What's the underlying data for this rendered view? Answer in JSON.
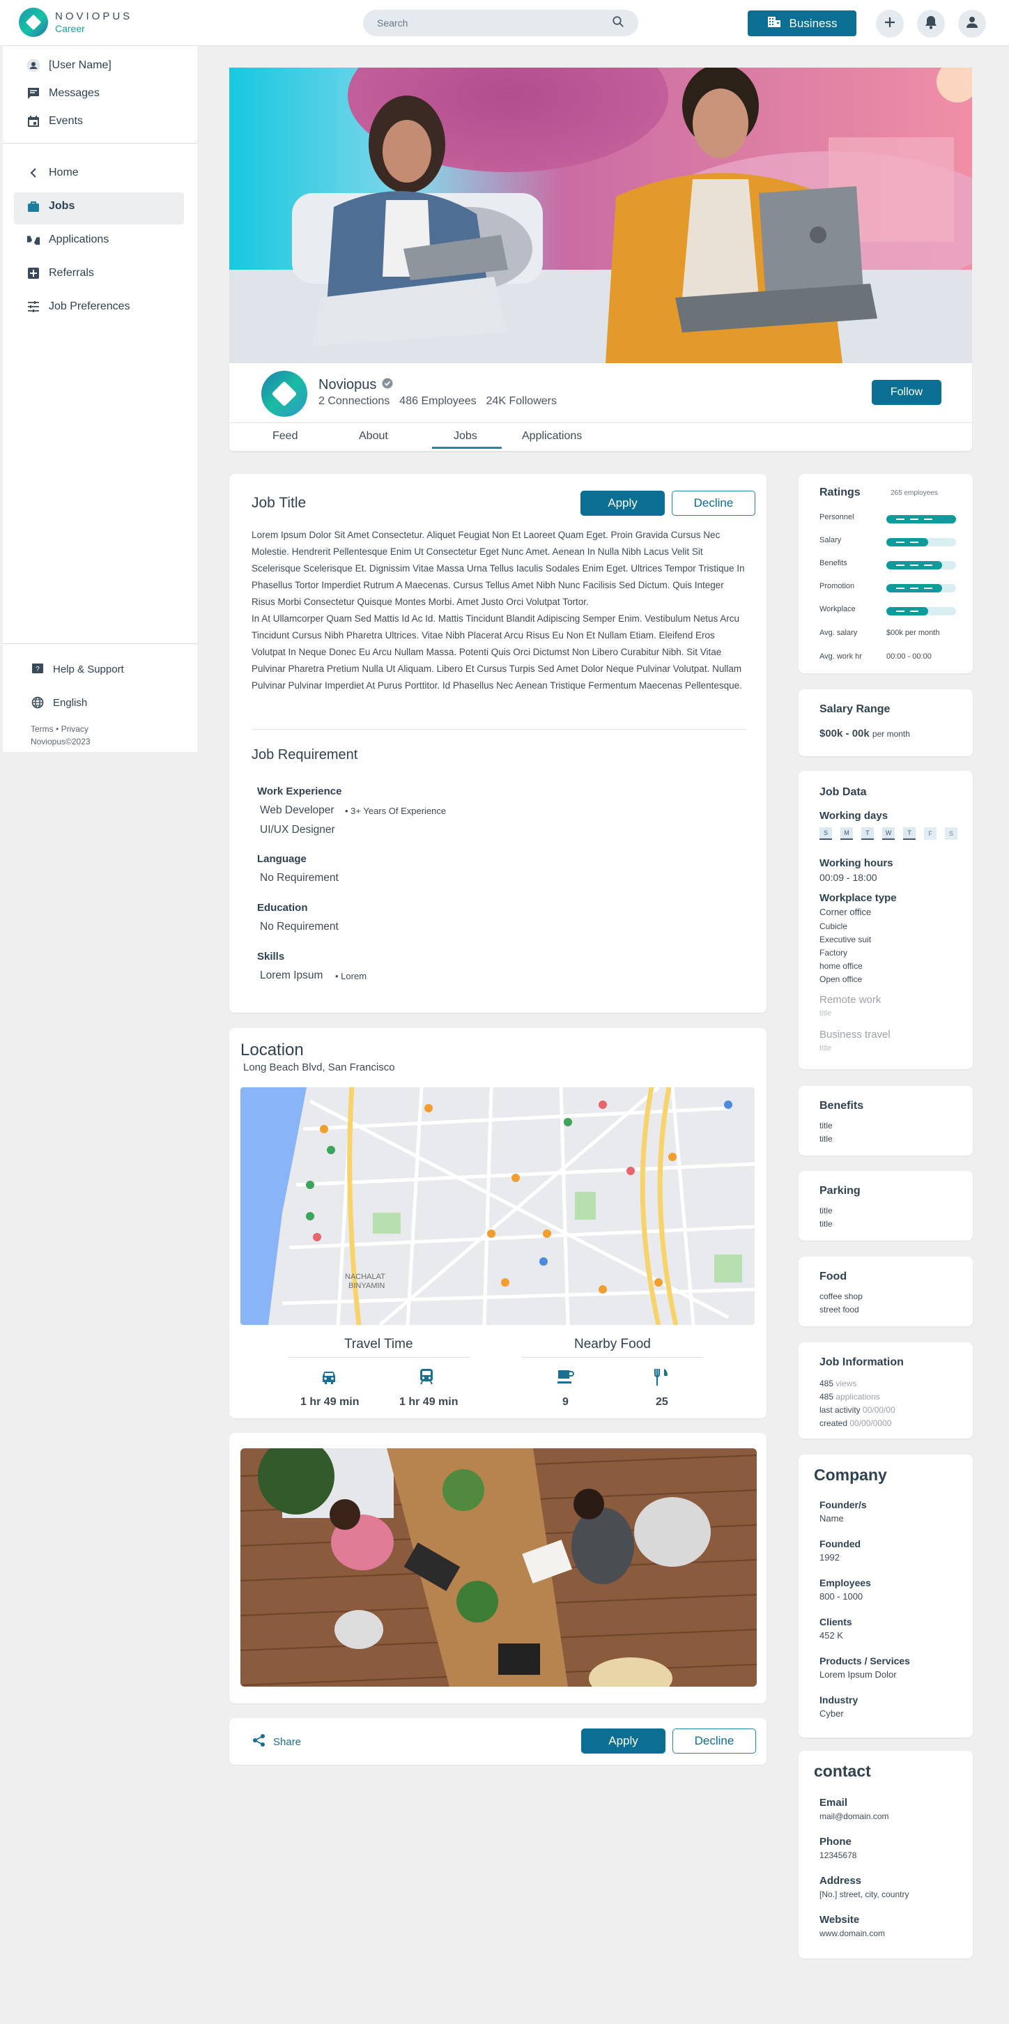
{
  "header": {
    "brand": "NOVIOPUS",
    "brand_sub": "Career",
    "search_placeholder": "Search",
    "business_label": "Business"
  },
  "sidebar": {
    "user_name": "[User Name]",
    "messages": "Messages",
    "events": "Events",
    "home": "Home",
    "jobs": "Jobs",
    "applications": "Applications",
    "referrals": "Referrals",
    "job_preferences": "Job Preferences",
    "help": "Help & Support",
    "language": "English",
    "terms": "Terms",
    "privacy": "Privacy",
    "copyright": "Noviopus©2023"
  },
  "company_profile": {
    "name": "Noviopus",
    "connections": "2 Connections",
    "employees": "486 Employees",
    "followers": "24K Followers",
    "follow_label": "Follow",
    "tabs": [
      "Feed",
      "About",
      "Jobs",
      "Applications"
    ],
    "active_tab": "Jobs"
  },
  "job": {
    "title": "Job Title",
    "apply_label": "Apply",
    "decline_label": "Decline",
    "description_p1": "Lorem Ipsum Dolor Sit Amet Consectetur. Aliquet Feugiat Non Et Laoreet Quam Eget. Proin Gravida Cursus Nec Molestie. Hendrerit Pellentesque Enim Ut Consectetur Eget Nunc Amet. Aenean In Nulla Nibh Lacus Velit Sit Scelerisque Scelerisque Et. Dignissim Vitae Massa Urna Tellus Iaculis Sodales Enim Eget. Ultrices Tempor Tristique In Phasellus Tortor Imperdiet Rutrum A Maecenas. Cursus Tellus Amet Nibh Nunc Facilisis Sed Dictum. Quis Integer Risus Morbi Consectetur Quisque Montes Morbi. Amet Justo Orci Volutpat Tortor.",
    "description_p2": "In At Ullamcorper Quam Sed Mattis Id Ac Id. Mattis Tincidunt Blandit Adipiscing Semper Enim. Vestibulum Netus Arcu Tincidunt Cursus Nibh Pharetra Ultrices. Vitae Nibh Placerat Arcu Risus Eu Non Et Nullam Etiam. Eleifend Eros Volutpat In Neque Donec Eu Arcu Nullam Massa. Potenti Quis Orci Dictumst Non Libero Curabitur Nibh. Sit Vitae Pulvinar Pharetra Pretium Nulla Ut Aliquam. Libero Et Cursus Turpis Sed Amet Dolor Neque Pulvinar Volutpat. Nullam Pulvinar Pulvinar Imperdiet At Purus Porttitor. Id Phasellus Nec Aenean Tristique Fermentum Maecenas Pellentesque.",
    "requirement_title": "Job Requirement",
    "work_experience_label": "Work Experience",
    "work_role_1": "Web Developer",
    "work_years": "3+ Years Of Experience",
    "work_role_2": "UI/UX Designer",
    "language_label": "Language",
    "language_value": "No Requirement",
    "education_label": "Education",
    "education_value": "No Requirement",
    "skills_label": "Skills",
    "skill_1": "Lorem Ipsum",
    "skill_2": "Lorem"
  },
  "location": {
    "title": "Location",
    "address": "Long Beach Blvd,  San Francisco",
    "travel_title": "Travel Time",
    "car_time": "1 hr 49 min",
    "transit_time": "1 hr 49 min",
    "food_title": "Nearby Food",
    "cafe_count": "9",
    "restaurant_count": "25",
    "map_labels": [
      "NACHALAT",
      "BINYAMIN"
    ]
  },
  "bottom_actions": {
    "share_label": "Share",
    "apply_label": "Apply",
    "decline_label": "Decline"
  },
  "ratings": {
    "title": "Ratings",
    "employees": "265 employees",
    "items": [
      {
        "label": "Personnel",
        "value": 1.0
      },
      {
        "label": "Salary",
        "value": 0.6
      },
      {
        "label": "Benefits",
        "value": 0.8
      },
      {
        "label": "Promotion",
        "value": 0.8
      },
      {
        "label": "Workplace",
        "value": 0.6
      }
    ],
    "avg_salary_label": "Avg. salary",
    "avg_salary_value": "$00k per month",
    "avg_work_label": "Avg. work hr",
    "avg_work_value": "00:00 - 00:00"
  },
  "salary": {
    "title": "Salary Range",
    "value": "$00k - 00k",
    "unit": "per month"
  },
  "job_data": {
    "title": "Job Data",
    "working_days_label": "Working days",
    "days": [
      "S",
      "M",
      "T",
      "W",
      "T",
      "F",
      "S"
    ],
    "working_hours_label": "Working hours",
    "working_hours_value": "00:09 - 18:00",
    "workplace_type_label": "Workplace type",
    "workplace_types": [
      "Corner office",
      "Cubicle",
      "Executive suit",
      "Factory",
      "home office",
      "Open office"
    ],
    "remote_label": "Remote work",
    "remote_value": "title",
    "travel_label": "Business travel",
    "travel_value": "title"
  },
  "benefits": {
    "title": "Benefits",
    "items": [
      "title",
      "title"
    ]
  },
  "parking": {
    "title": "Parking",
    "items": [
      "title",
      "title"
    ]
  },
  "food": {
    "title": "Food",
    "items": [
      "coffee shop",
      "street food"
    ]
  },
  "job_info": {
    "title": "Job Information",
    "views_num": "485",
    "views_label": "views",
    "applications_num": "485",
    "applications_label": "applications",
    "last_activity_label": "last activity",
    "last_activity_value": "00/00/00",
    "created_label": "created",
    "created_value": "00/00/0000"
  },
  "company": {
    "title": "Company",
    "founder_label": "Founder/s",
    "founder_value": "Name",
    "founded_label": "Founded",
    "founded_value": "1992",
    "employees_label": "Employees",
    "employees_value": "800 - 1000",
    "clients_label": "Clients",
    "clients_value": "452 K",
    "products_label": "Products / Services",
    "products_value": "Lorem Ipsum Dolor",
    "industry_label": "Industry",
    "industry_value": "Cyber"
  },
  "contact": {
    "title": "contact",
    "email_label": "Email",
    "email_value": "mail@domain.com",
    "phone_label": "Phone",
    "phone_value": "12345678",
    "address_label": "Address",
    "address_value": "[No.] street, city, country",
    "website_label": "Website",
    "website_value": "www.domain.com"
  },
  "colors": {
    "primary": "#0b6f93",
    "teal": "#12a5a5",
    "background": "#efefef"
  }
}
